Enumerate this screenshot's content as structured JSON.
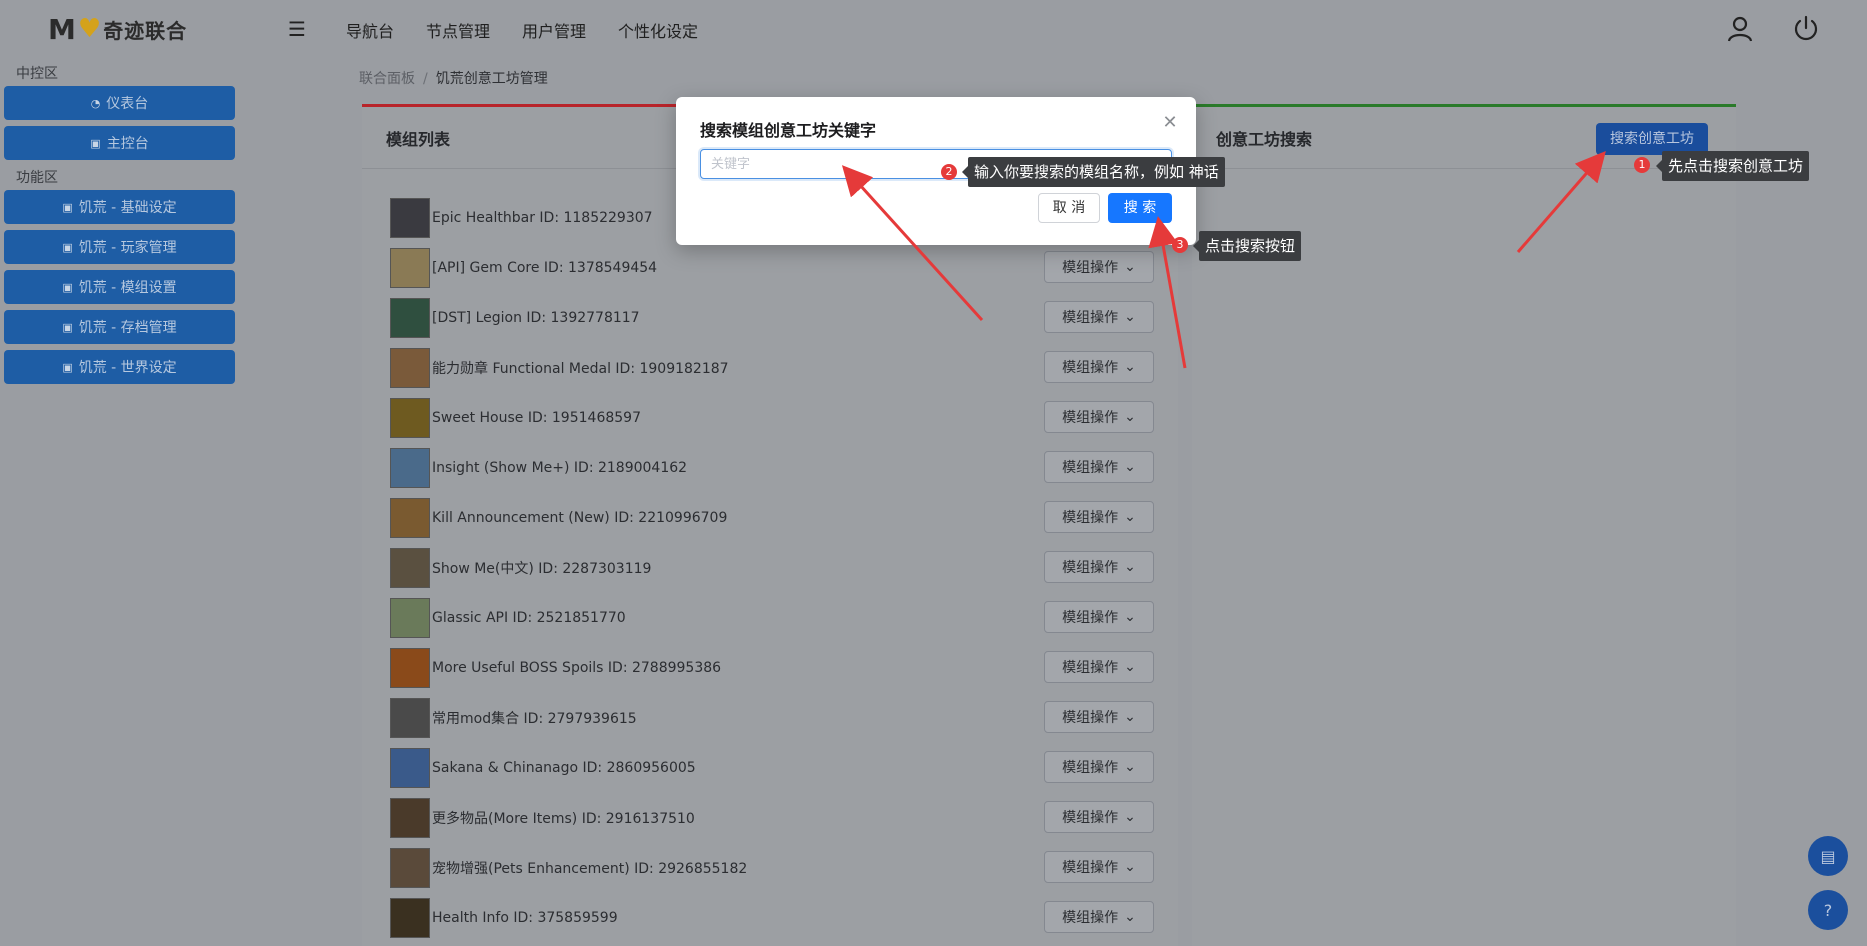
{
  "header": {
    "logo_mark": "M",
    "logo_name": "奇迹联合",
    "nav": [
      "导航台",
      "节点管理",
      "用户管理",
      "个性化设定"
    ]
  },
  "sidebar": {
    "sections": [
      {
        "title": "中控区",
        "items": [
          "仪表台",
          "主控台"
        ]
      },
      {
        "title": "功能区",
        "items": [
          "饥荒 - 基础设定",
          "饥荒 - 玩家管理",
          "饥荒 - 模组设置",
          "饥荒 - 存档管理",
          "饥荒 - 世界设定"
        ]
      }
    ]
  },
  "breadcrumb": {
    "root": "联合面板",
    "separator": "/",
    "current": "饥荒创意工坊管理"
  },
  "left_card": {
    "title": "模组列表",
    "op_label": "模组操作",
    "mods": [
      {
        "name": "Epic Healthbar ID: 1185229307",
        "color": "#3a3a40"
      },
      {
        "name": "[API] Gem Core ID: 1378549454",
        "color": "#8a7a55"
      },
      {
        "name": "[DST] Legion ID: 1392778117",
        "color": "#2f4f3f"
      },
      {
        "name": "能力勋章 Functional Medal ID: 1909182187",
        "color": "#7a5a3a"
      },
      {
        "name": "Sweet House ID: 1951468597",
        "color": "#6e5a20"
      },
      {
        "name": "Insight (Show Me+) ID: 2189004162",
        "color": "#4a6a8a"
      },
      {
        "name": "Kill Announcement (New) ID: 2210996709",
        "color": "#7a5a30"
      },
      {
        "name": "Show Me(中文) ID: 2287303119",
        "color": "#5a5040"
      },
      {
        "name": "Glassic API ID: 2521851770",
        "color": "#6a7a5a"
      },
      {
        "name": "More Useful BOSS Spoils ID: 2788995386",
        "color": "#8a4a1a"
      },
      {
        "name": "常用mod集合 ID: 2797939615",
        "color": "#4a4a4a"
      },
      {
        "name": "Sakana & Chinanago ID: 2860956005",
        "color": "#3a5a8a"
      },
      {
        "name": "更多物品(More Items) ID: 2916137510",
        "color": "#4a3a2a"
      },
      {
        "name": "宠物增强(Pets Enhancement) ID: 2926855182",
        "color": "#5a4a3a"
      },
      {
        "name": "Health Info ID: 375859599",
        "color": "#3a3020"
      }
    ]
  },
  "right_card": {
    "title": "创意工坊搜索",
    "button": "搜索创意工坊"
  },
  "modal": {
    "title": "搜索模组创意工坊关键字",
    "placeholder": "关键字",
    "cancel": "取 消",
    "search": "搜 索"
  },
  "annotations": [
    {
      "num": "1",
      "text": "先点击搜索创意工坊"
    },
    {
      "num": "2",
      "text": "输入你要搜索的模组名称，例如 神话"
    },
    {
      "num": "3",
      "text": "点击搜索按钮"
    }
  ],
  "colors": {
    "primary": "#1677ff",
    "sidebar_item": "#1e5da5",
    "arrow": "#e53a3a",
    "overlay": "#9a9da2"
  }
}
